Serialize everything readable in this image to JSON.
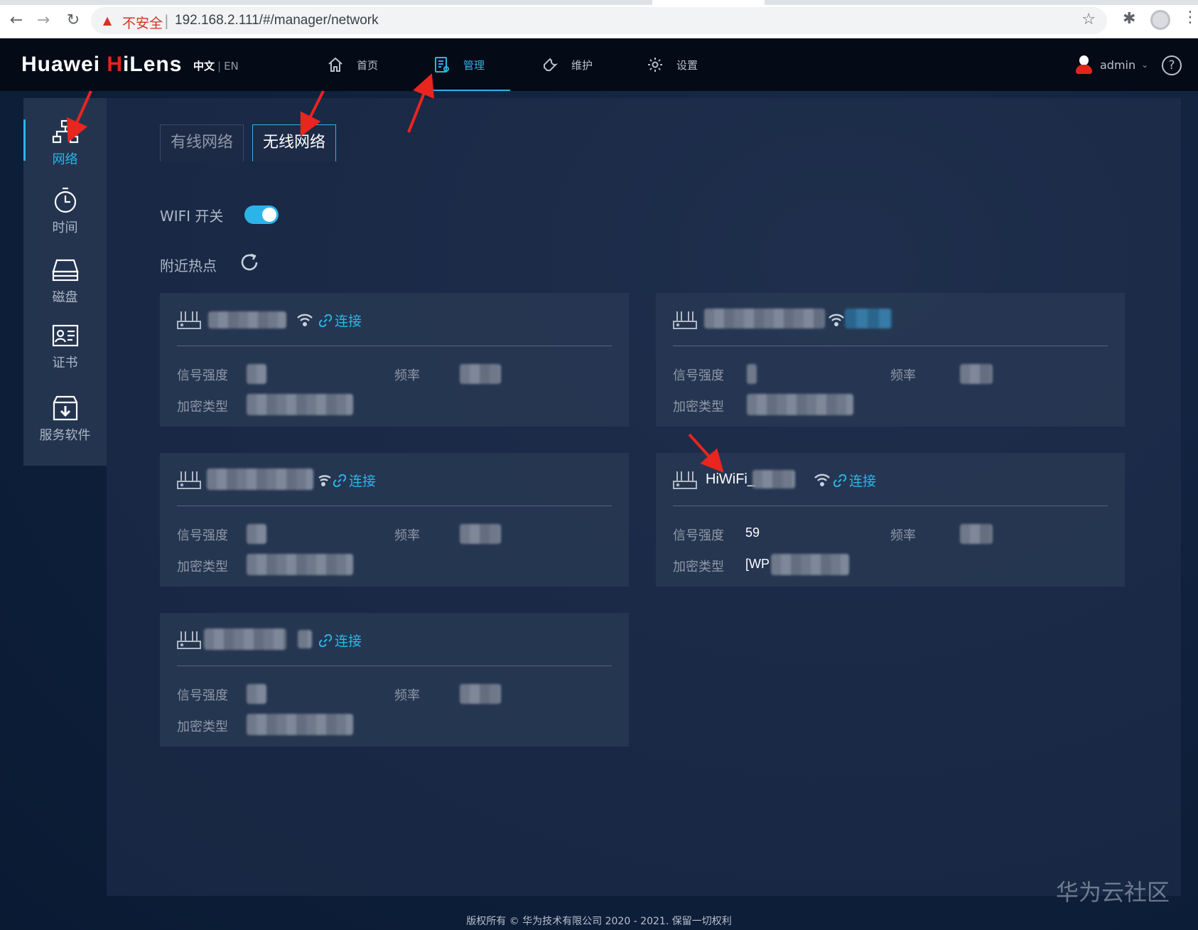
{
  "browser": {
    "insecure_label": "不安全",
    "separator": "|",
    "url": "192.168.2.111/#/manager/network"
  },
  "header": {
    "logo_main": "Huawei ",
    "logo_accent": "H",
    "logo_rest": "iLens",
    "lang_zh": "中文",
    "lang_sep": "|",
    "lang_en": "EN",
    "nav": [
      {
        "label": "首页",
        "icon": "home-icon"
      },
      {
        "label": "管理",
        "icon": "manage-icon",
        "active": true
      },
      {
        "label": "维护",
        "icon": "wrench-icon"
      },
      {
        "label": "设置",
        "icon": "gear-icon"
      }
    ],
    "user": "admin",
    "help": "?"
  },
  "sidebar": {
    "items": [
      {
        "label": "网络",
        "icon": "network-icon",
        "active": true
      },
      {
        "label": "时间",
        "icon": "clock-icon"
      },
      {
        "label": "磁盘",
        "icon": "disk-icon"
      },
      {
        "label": "证书",
        "icon": "certificate-icon"
      },
      {
        "label": "服务软件",
        "icon": "download-box-icon"
      }
    ]
  },
  "tabs": [
    {
      "label": "有线网络"
    },
    {
      "label": "无线网络",
      "active": true
    }
  ],
  "wifi": {
    "switch_label": "WIFI 开关",
    "switch_on": true,
    "nearby_label": "附近热点"
  },
  "labels": {
    "signal": "信号强度",
    "frequency": "频率",
    "encryption": "加密类型",
    "connect": "连接"
  },
  "hotspots": [
    {
      "ssid": "",
      "signal": "",
      "frequency": "",
      "encryption": ""
    },
    {
      "ssid": "",
      "signal": "",
      "frequency": "",
      "encryption": ""
    },
    {
      "ssid": "",
      "signal": "",
      "frequency": "",
      "encryption": ""
    },
    {
      "ssid": "HiWiFi_",
      "signal": "59",
      "frequency": "",
      "encryption": "[WP"
    },
    {
      "ssid": "",
      "signal": "",
      "frequency": "",
      "encryption": ""
    }
  ],
  "footer": "版权所有 © 华为技术有限公司 2020 - 2021. 保留一切权利",
  "watermark": "华为云社区",
  "colors": {
    "accent": "#2bb4e8",
    "brand_red": "#e1251b",
    "annotation_red": "#e8251f"
  }
}
